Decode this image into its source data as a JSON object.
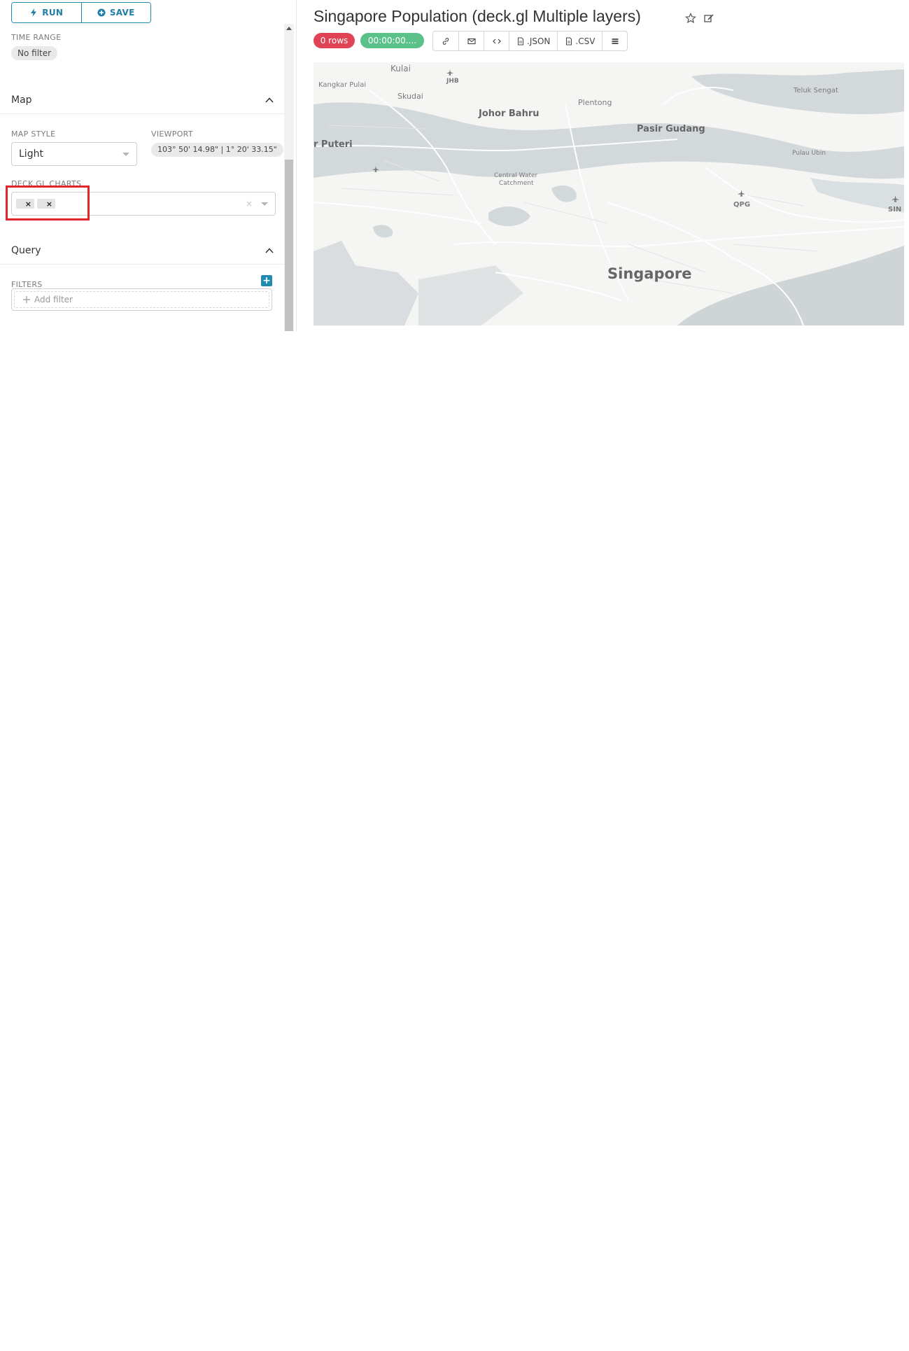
{
  "toolbar": {
    "run_label": "RUN",
    "save_label": "SAVE"
  },
  "time_range": {
    "label": "TIME RANGE",
    "value": "No filter"
  },
  "sections": {
    "map": {
      "title": "Map"
    },
    "query": {
      "title": "Query"
    }
  },
  "map_style": {
    "label": "MAP STYLE",
    "value": "Light"
  },
  "viewport": {
    "label": "VIEWPORT",
    "value": "103° 50' 14.98\" | 1° 20' 33.15\""
  },
  "deck_charts": {
    "label": "DECK.GL CHARTS",
    "tags": [
      "×",
      "×"
    ],
    "clear": "×"
  },
  "filters": {
    "label": "FILTERS",
    "add_icon": "+",
    "add_label": "Add filter"
  },
  "chart": {
    "title": "Singapore Population (deck.gl Multiple layers)",
    "rows_badge": "0 rows",
    "time_badge": "00:00:00....",
    "rows_color": "#e04355",
    "time_color": "#5ac189"
  },
  "actions": {
    "json": ".JSON",
    "csv": ".CSV"
  },
  "map_labels": {
    "kulai": "Kulai",
    "jhb": "JHB",
    "kangkar_pulai": "Kangkar Pulai",
    "skudai": "Skudai",
    "plentong": "Plentong",
    "teluk_sengat": "Teluk Sengat",
    "johor_bahru": "Johor Bahru",
    "pasir_gudang": "Pasir Gudang",
    "puteri": "r Puteri",
    "pulau_ubin": "Pulau Ubin",
    "central_water": "Central Water",
    "catchment": "Catchment",
    "qpg": "QPG",
    "sin": "SIN",
    "singapore": "Singapore"
  },
  "colors": {
    "accent": "#1f8bb0",
    "highlight": "#e0262b",
    "water": "#cfd4d6",
    "land": "#f5f5f4"
  }
}
